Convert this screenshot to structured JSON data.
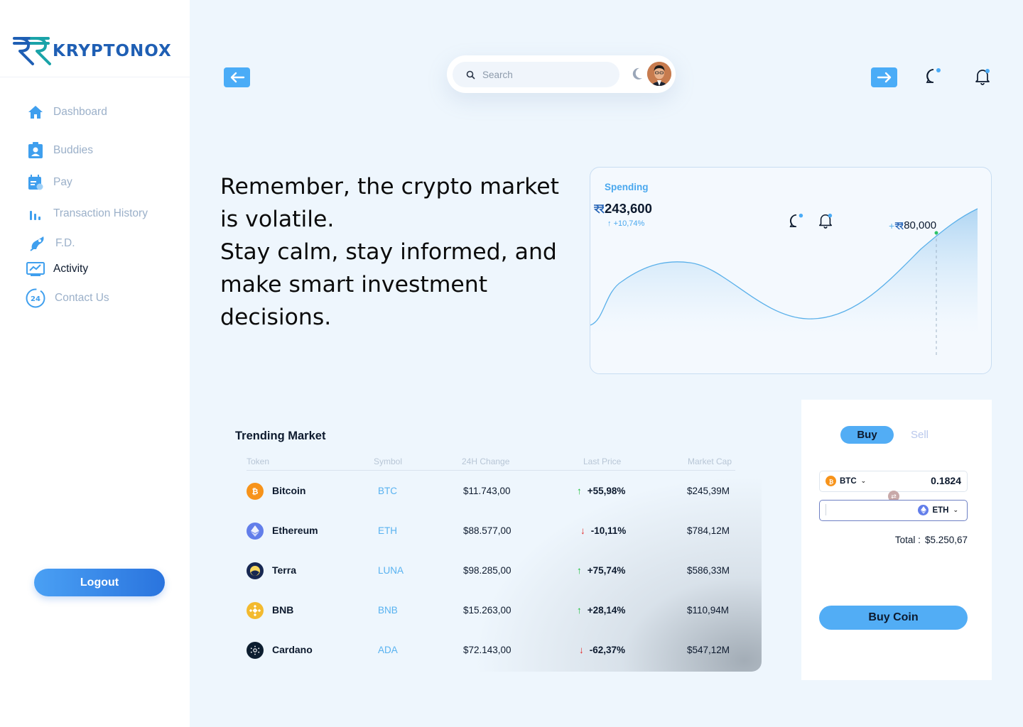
{
  "brand": {
    "name": "KRYPTONOX"
  },
  "sidebar": {
    "items": [
      {
        "label": "Dashboard",
        "icon": "home-icon"
      },
      {
        "label": "Buddies",
        "icon": "id-badge-icon"
      },
      {
        "label": "Pay",
        "icon": "calendar-pay-icon"
      },
      {
        "label": "Transaction History",
        "icon": "bar-chart-icon"
      },
      {
        "label": "F.D.",
        "icon": "fd-icon"
      },
      {
        "label": "Activity",
        "icon": "activity-monitor-icon",
        "active": true
      },
      {
        "label": "Contact Us",
        "icon": "support-24-icon"
      }
    ],
    "logout_label": "Logout"
  },
  "topbar": {
    "search_placeholder": "Search"
  },
  "headline": {
    "line1": "Remember, the crypto market is volatile.",
    "line2": "Stay calm, stay informed, and make smart investment decisions."
  },
  "spending": {
    "title": "Spending",
    "amount": "243,600",
    "change": "+10,74%",
    "peak_label": "80,000"
  },
  "market": {
    "title": "Trending Market",
    "columns": [
      "Token",
      "Symbol",
      "24H Change",
      "Last Price",
      "Market Cap"
    ],
    "rows": [
      {
        "name": "Bitcoin",
        "symbol": "BTC",
        "change24h": "$11.743,00",
        "last_price": "+55,98%",
        "direction": "up",
        "market_cap": "$245,39M",
        "color": "#f7931a"
      },
      {
        "name": "Ethereum",
        "symbol": "ETH",
        "change24h": "$88.577,00",
        "last_price": "-10,11%",
        "direction": "down",
        "market_cap": "$784,12M",
        "color": "#627eea"
      },
      {
        "name": "Terra",
        "symbol": "LUNA",
        "change24h": "$98.285,00",
        "last_price": "+75,74%",
        "direction": "up",
        "market_cap": "$586,33M",
        "color": "#172852"
      },
      {
        "name": "BNB",
        "symbol": "BNB",
        "change24h": "$15.263,00",
        "last_price": "+28,14%",
        "direction": "up",
        "market_cap": "$110,94M",
        "color": "#f3ba2f"
      },
      {
        "name": "Cardano",
        "symbol": "ADA",
        "change24h": "$72.143,00",
        "last_price": "-62,37%",
        "direction": "down",
        "market_cap": "$547,12M",
        "color": "#0d1e30"
      }
    ]
  },
  "trade": {
    "tab_buy": "Buy",
    "tab_sell": "Sell",
    "from_coin": "BTC",
    "from_amount": "0.1824",
    "to_coin": "ETH",
    "total_label": "Total :",
    "total_value": "$5.250,67",
    "buy_button": "Buy Coin"
  },
  "colors": {
    "accent": "#4aacf7",
    "up": "#1bbf3a",
    "down": "#e32222",
    "background": "#eef6fd"
  }
}
